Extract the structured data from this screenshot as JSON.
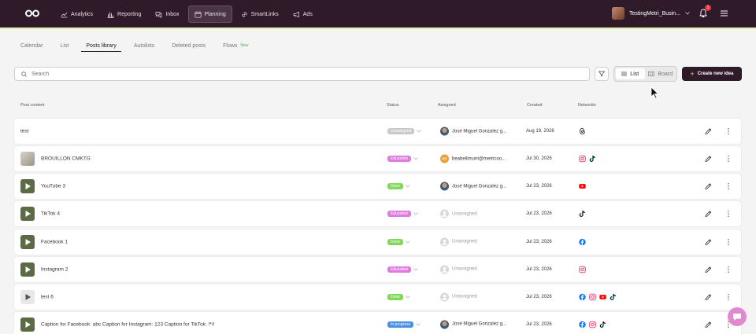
{
  "nav": {
    "items": [
      {
        "label": "Analytics",
        "icon": "analytics-icon"
      },
      {
        "label": "Reporting",
        "icon": "reporting-icon"
      },
      {
        "label": "Inbox",
        "icon": "inbox-icon"
      },
      {
        "label": "Planning",
        "icon": "calendar-icon",
        "active": true
      },
      {
        "label": "SmartLinks",
        "icon": "link-icon"
      },
      {
        "label": "Ads",
        "icon": "megaphone-icon"
      }
    ],
    "account_name": "TestingMetri_Busin...",
    "notification_count": "1"
  },
  "tabs": [
    {
      "label": "Calendar"
    },
    {
      "label": "List"
    },
    {
      "label": "Posts library",
      "active": true
    },
    {
      "label": "Autolists"
    },
    {
      "label": "Deleted posts"
    },
    {
      "label": "Flows",
      "badge": "New"
    }
  ],
  "search": {
    "placeholder": "Search"
  },
  "view_toggle": {
    "list": "List",
    "board": "Board"
  },
  "create_button": "Create new idea",
  "columns": {
    "content": "Post content",
    "status": "Status",
    "assigned": "Assigned",
    "created": "Created",
    "networks": "Networks"
  },
  "status_colors": {
    "Unassigned": "#c9c9c9",
    "Education": "#e07be0",
    "Done": "#7ed957",
    "In progress": "#4a90e2"
  },
  "network_colors": {
    "threads": "#111111",
    "instagram": "#e1306c",
    "tiktok": "#111111",
    "youtube": "#ff0000",
    "facebook": "#1877f2"
  },
  "rows": [
    {
      "title": "test",
      "thumb": "none",
      "status": "Unassigned",
      "assignee": "José Miguel Gonzalez g...",
      "avatar": "photo",
      "created": "Aug 19, 2026",
      "networks": [
        "threads"
      ]
    },
    {
      "title": "BROUILLON CMKTG",
      "thumb": "photo",
      "status": "Education",
      "assignee": "beabellimunt@metricoo...",
      "avatar": "orange",
      "avatar_initials": "BE",
      "created": "Jul 30, 2026",
      "networks": [
        "instagram",
        "tiktok"
      ]
    },
    {
      "title": "YouTube 3",
      "thumb": "video",
      "status": "Done",
      "assignee": "José Miguel Gonzalez g...",
      "avatar": "photo",
      "created": "Jul 23, 2026",
      "networks": [
        "youtube"
      ]
    },
    {
      "title": "TikTok 4",
      "thumb": "video",
      "status": "Education",
      "assignee": "Unassigned",
      "avatar": "grey",
      "created": "Jul 23, 2026",
      "networks": [
        "tiktok"
      ]
    },
    {
      "title": "Facebook 1",
      "thumb": "video",
      "status": "Done",
      "assignee": "Unassigned",
      "avatar": "grey",
      "created": "Jul 23, 2026",
      "networks": [
        "facebook"
      ]
    },
    {
      "title": "Instagram 2",
      "thumb": "video",
      "status": "Education",
      "assignee": "Unassigned",
      "avatar": "grey",
      "created": "Jul 23, 2026",
      "networks": [
        "instagram"
      ]
    },
    {
      "title": "test 6",
      "thumb": "white",
      "status": "Done",
      "assignee": "Unassigned",
      "avatar": "grey",
      "created": "Jul 23, 2026",
      "networks": [
        "facebook",
        "instagram",
        "youtube",
        "tiktok"
      ]
    },
    {
      "title": "Caption for Facebook: abc Caption for Instagram: 123 Caption for TikTok: !*#",
      "thumb": "video",
      "status": "In progress",
      "assignee": "José Miguel Gonzalez g...",
      "avatar": "photo",
      "created": "Jul 23, 2026",
      "networks": [
        "facebook",
        "instagram",
        "tiktok"
      ]
    }
  ]
}
